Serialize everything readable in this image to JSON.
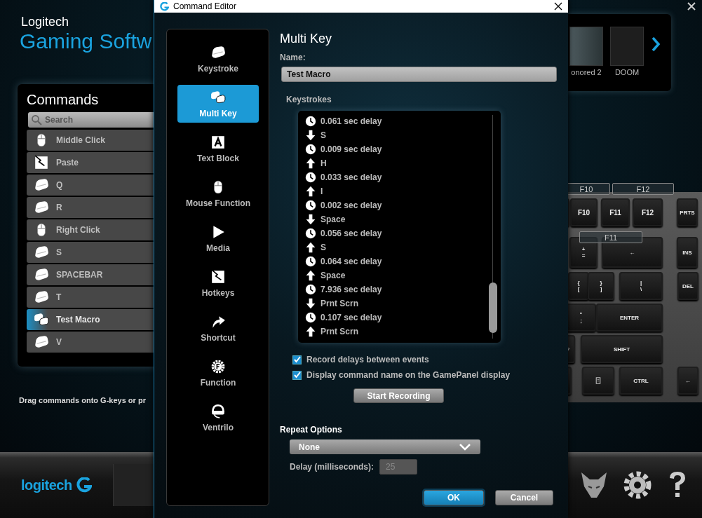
{
  "app": {
    "brand": "Logitech",
    "title": "Gaming Softw"
  },
  "commands": {
    "title": "Commands",
    "search": {
      "placeholder": "Search"
    },
    "items": [
      {
        "label": "Middle Click",
        "kind": "mouse",
        "selected": false
      },
      {
        "label": "Paste",
        "kind": "hotkey",
        "selected": false
      },
      {
        "label": "Q",
        "kind": "key",
        "selected": false
      },
      {
        "label": "R",
        "kind": "key",
        "selected": false
      },
      {
        "label": "Right Click",
        "kind": "mouse",
        "selected": false
      },
      {
        "label": "S",
        "kind": "key",
        "selected": false
      },
      {
        "label": "SPACEBAR",
        "kind": "key",
        "selected": false
      },
      {
        "label": "T",
        "kind": "key",
        "selected": false
      },
      {
        "label": "Test Macro",
        "kind": "multikey",
        "selected": true
      },
      {
        "label": "V",
        "kind": "key",
        "selected": false
      }
    ],
    "hint": "Drag commands onto G-keys or pr"
  },
  "profiles": [
    {
      "label": "onored 2",
      "selected": false
    },
    {
      "label": "DOOM",
      "selected": false
    }
  ],
  "keyboard": {
    "callouts": [
      "F10",
      "F12",
      "F11"
    ],
    "keys": [
      {
        "kind": "blank"
      },
      {
        "kind": "key",
        "top": "F10"
      },
      {
        "kind": "key",
        "top": "F11"
      },
      {
        "kind": "key",
        "top": "F12"
      },
      {
        "kind": "key",
        "top": "PRTS"
      },
      {
        "kind": "blank"
      },
      {
        "kind": "key",
        "top": "+",
        "bottom": "="
      },
      {
        "kind": "key",
        "top": "←"
      },
      {
        "kind": "key",
        "top": "INS"
      },
      {
        "kind": "key",
        "top": "{",
        "bottom": "["
      },
      {
        "kind": "key",
        "top": "}",
        "bottom": "]"
      },
      {
        "kind": "key",
        "top": "|",
        "bottom": "\\"
      },
      {
        "kind": "key",
        "top": "DEL"
      },
      {
        "kind": "key",
        "top": "\"",
        "bottom": ";"
      },
      {
        "kind": "key",
        "top": "ENTER"
      },
      {
        "kind": "key",
        "top": "?"
      },
      {
        "kind": "key",
        "top": "SHIFT"
      },
      {
        "kind": "blank"
      },
      {
        "kind": "menu"
      },
      {
        "kind": "key",
        "top": "CTRL"
      },
      {
        "kind": "key",
        "top": "←"
      }
    ]
  },
  "footer": {
    "logo": "logitech"
  },
  "dialog": {
    "title": "Command Editor",
    "types": [
      {
        "label": "Keystroke",
        "kind": "key",
        "selected": false
      },
      {
        "label": "Multi Key",
        "kind": "multikey",
        "selected": true
      },
      {
        "label": "Text Block",
        "kind": "text",
        "selected": false
      },
      {
        "label": "Mouse Function",
        "kind": "mouse",
        "selected": false
      },
      {
        "label": "Media",
        "kind": "media",
        "selected": false
      },
      {
        "label": "Hotkeys",
        "kind": "hotkey",
        "selected": false
      },
      {
        "label": "Shortcut",
        "kind": "shortcut",
        "selected": false
      },
      {
        "label": "Function",
        "kind": "function",
        "selected": false
      },
      {
        "label": "Ventrilo",
        "kind": "headset",
        "selected": false
      }
    ],
    "heading": "Multi Key",
    "name_label": "Name:",
    "name_value": "Test Macro",
    "keystrokes_label": "Keystrokes",
    "keystrokes": [
      {
        "kind": "delay",
        "text": "0.061 sec delay"
      },
      {
        "kind": "down",
        "text": "S"
      },
      {
        "kind": "delay",
        "text": "0.009 sec delay"
      },
      {
        "kind": "up",
        "text": "H"
      },
      {
        "kind": "delay",
        "text": "0.033 sec delay"
      },
      {
        "kind": "up",
        "text": "I"
      },
      {
        "kind": "delay",
        "text": "0.002 sec delay"
      },
      {
        "kind": "down",
        "text": "Space"
      },
      {
        "kind": "delay",
        "text": "0.056 sec delay"
      },
      {
        "kind": "up",
        "text": "S"
      },
      {
        "kind": "delay",
        "text": "0.064 sec delay"
      },
      {
        "kind": "up",
        "text": "Space"
      },
      {
        "kind": "delay",
        "text": "7.936 sec delay"
      },
      {
        "kind": "down",
        "text": "Prnt Scrn"
      },
      {
        "kind": "delay",
        "text": "0.107 sec delay"
      },
      {
        "kind": "up",
        "text": "Prnt Scrn"
      }
    ],
    "options": [
      {
        "label": "Record delays between events",
        "checked": true
      },
      {
        "label": "Display command name on the GamePanel display",
        "checked": true
      }
    ],
    "record_button": "Start Recording",
    "repeat": {
      "label": "Repeat Options",
      "value": "None",
      "delay_label": "Delay (milliseconds):",
      "delay_value": "25"
    },
    "buttons": [
      {
        "label": "OK",
        "kind": "primary"
      },
      {
        "label": "Cancel",
        "kind": "secondary"
      }
    ]
  }
}
